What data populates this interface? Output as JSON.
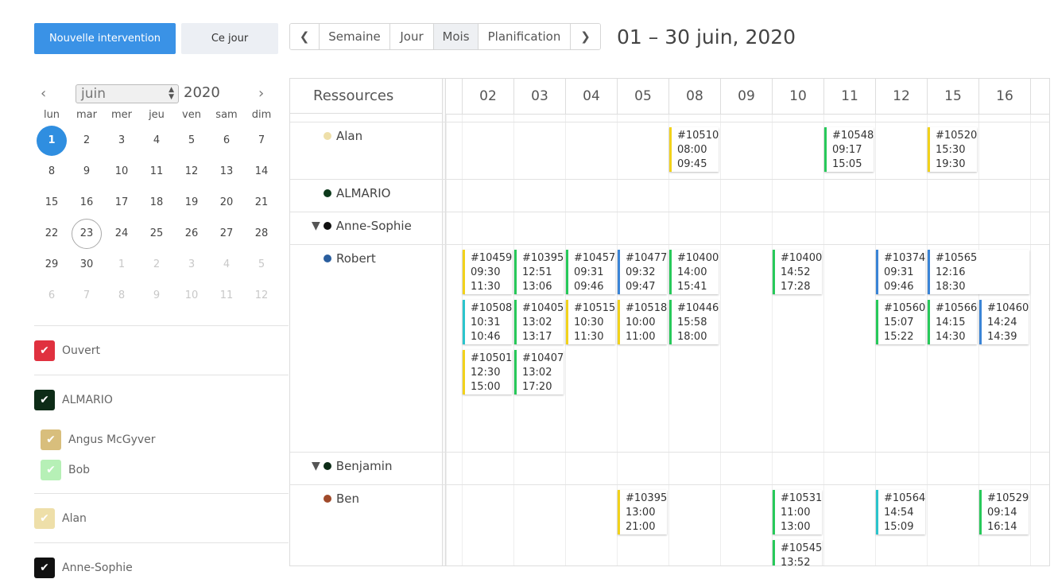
{
  "toolbar": {
    "new_label": "Nouvelle intervention",
    "today_label": "Ce jour",
    "prev_icon": "❮",
    "next_icon": "❯",
    "views": [
      "Semaine",
      "Jour",
      "Mois",
      "Planification"
    ],
    "active_view": "Mois",
    "range_title": "01 – 30 juin, 2020"
  },
  "mini_calendar": {
    "month": "juin",
    "year": "2020",
    "weekdays": [
      "lun",
      "mar",
      "mer",
      "jeu",
      "ven",
      "sam",
      "dim"
    ],
    "weeks": [
      [
        "1",
        "2",
        "3",
        "4",
        "5",
        "6",
        "7"
      ],
      [
        "8",
        "9",
        "10",
        "11",
        "12",
        "13",
        "14"
      ],
      [
        "15",
        "16",
        "17",
        "18",
        "19",
        "20",
        "21"
      ],
      [
        "22",
        "23",
        "24",
        "25",
        "26",
        "27",
        "28"
      ],
      [
        "29",
        "30",
        "1",
        "2",
        "3",
        "4",
        "5"
      ],
      [
        "6",
        "7",
        "8",
        "9",
        "10",
        "11",
        "12"
      ]
    ],
    "today": "1",
    "selected": "23"
  },
  "filters": {
    "groups": [
      {
        "label": "Ouvert",
        "color": "#e0313f",
        "checked": true,
        "subs": []
      },
      {
        "label": "ALMARIO",
        "color": "#0d2c17",
        "checked": true,
        "subs": [
          {
            "label": "Angus McGyver",
            "color": "#d8be7c",
            "checked": true
          },
          {
            "label": "Bob",
            "color": "#b6f0b6",
            "checked": true
          }
        ]
      },
      {
        "label": "Alan",
        "color": "#eedfa9",
        "checked": true,
        "subs": []
      },
      {
        "label": "Anne-Sophie",
        "color": "#111111",
        "checked": true,
        "subs": []
      }
    ]
  },
  "scheduler": {
    "resources_header": "Ressources",
    "days": [
      "02",
      "03",
      "04",
      "05",
      "08",
      "09",
      "10",
      "11",
      "12",
      "15",
      "16"
    ],
    "rows": [
      {
        "label": "Alan",
        "dot": "#eedfa9",
        "tri": false
      },
      {
        "label": "ALMARIO",
        "dot": "#0d3a1c",
        "tri": false
      },
      {
        "label": "Anne-Sophie",
        "dot": "#111111",
        "tri": true
      },
      {
        "label": "Robert",
        "dot": "#2a5e9e",
        "tri": false
      },
      {
        "label": "Benjamin",
        "dot": "#0d2c17",
        "tri": true
      },
      {
        "label": "Ben",
        "dot": "#a04a2a",
        "tri": false
      }
    ],
    "events": [
      {
        "row": 0,
        "day": 4,
        "slot": 0,
        "id": "#10510",
        "start": "08:00",
        "end": "09:45",
        "color": "#f2d21b"
      },
      {
        "row": 0,
        "day": 7,
        "slot": 0,
        "id": "#10548",
        "start": "09:17",
        "end": "15:05",
        "color": "#27c95a"
      },
      {
        "row": 0,
        "day": 9,
        "slot": 0,
        "id": "#10520",
        "start": "15:30",
        "end": "19:30",
        "color": "#f2d21b"
      },
      {
        "row": 3,
        "day": 0,
        "slot": 0,
        "id": "#10459",
        "start": "09:30",
        "end": "11:30",
        "color": "#f2d21b"
      },
      {
        "row": 3,
        "day": 1,
        "slot": 0,
        "id": "#10395",
        "start": "12:51",
        "end": "13:06",
        "color": "#27c95a"
      },
      {
        "row": 3,
        "day": 2,
        "slot": 0,
        "id": "#10457",
        "start": "09:31",
        "end": "09:46",
        "color": "#27c95a"
      },
      {
        "row": 3,
        "day": 3,
        "slot": 0,
        "id": "#10477",
        "start": "09:32",
        "end": "09:47",
        "color": "#3a84d6"
      },
      {
        "row": 3,
        "day": 4,
        "slot": 0,
        "id": "#10400",
        "start": "14:00",
        "end": "15:41",
        "color": "#27c95a"
      },
      {
        "row": 3,
        "day": 6,
        "slot": 0,
        "id": "#10400",
        "start": "14:52",
        "end": "17:28",
        "color": "#27c95a"
      },
      {
        "row": 3,
        "day": 8,
        "slot": 0,
        "id": "#10374",
        "start": "09:31",
        "end": "09:46",
        "color": "#3a84d6"
      },
      {
        "row": 3,
        "day": 9,
        "slot": 0,
        "id": "#10565",
        "start": "12:16",
        "end": "18:30",
        "color": "#3a84d6",
        "wide": true
      },
      {
        "row": 3,
        "day": 0,
        "slot": 1,
        "id": "#10508",
        "start": "10:31",
        "end": "10:46",
        "color": "#2bc4cc"
      },
      {
        "row": 3,
        "day": 1,
        "slot": 1,
        "id": "#10405",
        "start": "13:02",
        "end": "13:17",
        "color": "#27c95a"
      },
      {
        "row": 3,
        "day": 2,
        "slot": 1,
        "id": "#10515",
        "start": "10:30",
        "end": "11:30",
        "color": "#f2d21b"
      },
      {
        "row": 3,
        "day": 3,
        "slot": 1,
        "id": "#10518",
        "start": "10:00",
        "end": "11:00",
        "color": "#f2d21b"
      },
      {
        "row": 3,
        "day": 4,
        "slot": 1,
        "id": "#10446",
        "start": "15:58",
        "end": "18:00",
        "color": "#27c95a"
      },
      {
        "row": 3,
        "day": 8,
        "slot": 1,
        "id": "#10560",
        "start": "15:07",
        "end": "15:22",
        "color": "#27c95a"
      },
      {
        "row": 3,
        "day": 9,
        "slot": 1,
        "id": "#10566",
        "start": "14:15",
        "end": "14:30",
        "color": "#27c95a"
      },
      {
        "row": 3,
        "day": 10,
        "slot": 1,
        "id": "#10460",
        "start": "14:24",
        "end": "14:39",
        "color": "#3a84d6"
      },
      {
        "row": 3,
        "day": 0,
        "slot": 2,
        "id": "#10501",
        "start": "12:30",
        "end": "15:00",
        "color": "#f2d21b"
      },
      {
        "row": 3,
        "day": 1,
        "slot": 2,
        "id": "#10407",
        "start": "13:02",
        "end": "17:20",
        "color": "#27c95a"
      },
      {
        "row": 5,
        "day": 3,
        "slot": 0,
        "id": "#10395",
        "start": "13:00",
        "end": "21:00",
        "color": "#f2d21b"
      },
      {
        "row": 5,
        "day": 6,
        "slot": 0,
        "id": "#10531",
        "start": "11:00",
        "end": "13:00",
        "color": "#27c95a"
      },
      {
        "row": 5,
        "day": 8,
        "slot": 0,
        "id": "#10564",
        "start": "14:54",
        "end": "15:09",
        "color": "#2bc4cc"
      },
      {
        "row": 5,
        "day": 10,
        "slot": 0,
        "id": "#10529",
        "start": "09:14",
        "end": "16:14",
        "color": "#27c95a"
      },
      {
        "row": 5,
        "day": 6,
        "slot": 1,
        "id": "#10545",
        "start": "13:52",
        "end": "",
        "color": "#27c95a"
      }
    ]
  }
}
